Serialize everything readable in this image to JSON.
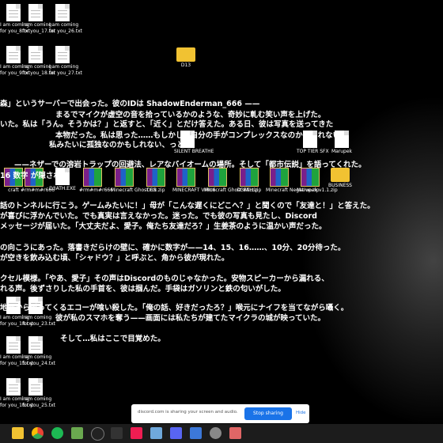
{
  "desktop_icons": {
    "files": [
      {
        "label1": "I am coming",
        "label2": "for you_8.txt"
      },
      {
        "label1": "I am coming",
        "label2": "for you_17.txt"
      },
      {
        "label1": "I am coming",
        "label2": "for you_26.txt"
      },
      {
        "label1": "I am coming",
        "label2": "for you_9.txt"
      },
      {
        "label1": "I am coming",
        "label2": "for you_18.txt"
      },
      {
        "label1": "I am coming",
        "label2": "for you_27.txt"
      },
      {
        "label1": "I am coming",
        "label2": "for you_14.txt"
      },
      {
        "label1": "I am coming",
        "label2": "for you_23.txt"
      },
      {
        "label1": "I am coming",
        "label2": "for you_15.txt"
      },
      {
        "label1": "I am coming",
        "label2": "for you_24.txt"
      },
      {
        "label1": "I am coming",
        "label2": "for you_16.txt"
      },
      {
        "label1": "I am coming",
        "label2": "for you_25.txt"
      }
    ],
    "d13_folder": "D13",
    "silent_breathe": "SILENT BREATHE",
    "top_tier_sfx": "TOP TIER SFX",
    "marupek": "Marupek",
    "row_labels": [
      "craft",
      "#rm#m#r666",
      "D3ATH.EXE",
      "#rm#m#r666",
      "Minecraft Ghost EN",
      "D13.zip",
      "MINECRAFT VIRUS",
      "Minecraft Ghost EN.zip",
      "D3ATH.zip",
      "Minecraft Negative.zip",
      "Marupek v1.1.zip",
      "BUSINESS"
    ]
  },
  "story": {
    "line1": "森」というサーバーで出会った。彼のIDは ShadowEnderman_666 ——",
    "line2": "まるでマイクが虚空の音を拾っているかのような、奇妙に軋む笑い声を上げた。",
    "line3": "いた。私は「うん。そうかは？」と返すと、「近く」とだけ答えた。ある日、彼は写真を送ってきた",
    "line4": "本物だった。私は思った……もしかして自分の手がコンプレックスなのかもしれない。",
    "line5": "私みたいに孤独なのかもしれない、っと。",
    "line6": "——ネザーでの溶岩トラップの回避法、レアなバイオームの場所。そして「都市伝説」を語ってくれた。",
    "line7": "16 数字 が隠されて",
    "line8": "話のトンネルに行こう。ゲームみたいに！」母が「こんな遅くにどこへ？」と聞くので「友達と！」と答えた。",
    "line9": "が喜びに浮かんでいた。でも真実は言えなかった。迷った。でも彼の写真も見たし、Discord",
    "line10": "メッセージが届いた。「大丈夫だよ、愛子。俺たち友達だろ？」生姜茶のように温かい声だった。",
    "line11": "の向こうにあった。落書きだらけの壁に、確かに数字が——14、15、16……、10分、20分待った。",
    "line12": "が空きを飲み込む頃、「シャドウ？」と呼ぶと、角から彼が現れた。",
    "line13": "クセル模様。「やあ、愛子」その声はDiscordのものじゃなかった。安物スピーカーから漏れる、",
    "line14": "れる声。後ずさりした私の手首を、彼は掴んだ。手袋はガソリンと鉄の匂いがした。",
    "line15": "地面から返ってくるエコーが喰い殺した。「俺の話、好きだったろ？」喉元にナイフを当てながら囁く。",
    "line16": "彼が私のスマホを奪う——画面には私たちが建てたマイクラの城が映っていた。",
    "line17": "そして…私はここで目覚めた。"
  },
  "share_bar": {
    "message": "discord.com is sharing your screen and audio.",
    "stop_label": "Stop sharing",
    "hide_label": "Hide"
  },
  "colors": {
    "desktop_bg": "#000000",
    "taskbar_bg": "#1c1c1c",
    "stop_button": "#1a73e8"
  },
  "taskbar_icons": [
    "file-explorer-icon",
    "chrome-icon",
    "spotify-icon",
    "minecraft-icon",
    "clock-icon",
    "capcut-icon",
    "tiktok-icon",
    "app-icon",
    "discord-icon",
    "media-icon",
    "settings-icon",
    "paint-icon"
  ]
}
